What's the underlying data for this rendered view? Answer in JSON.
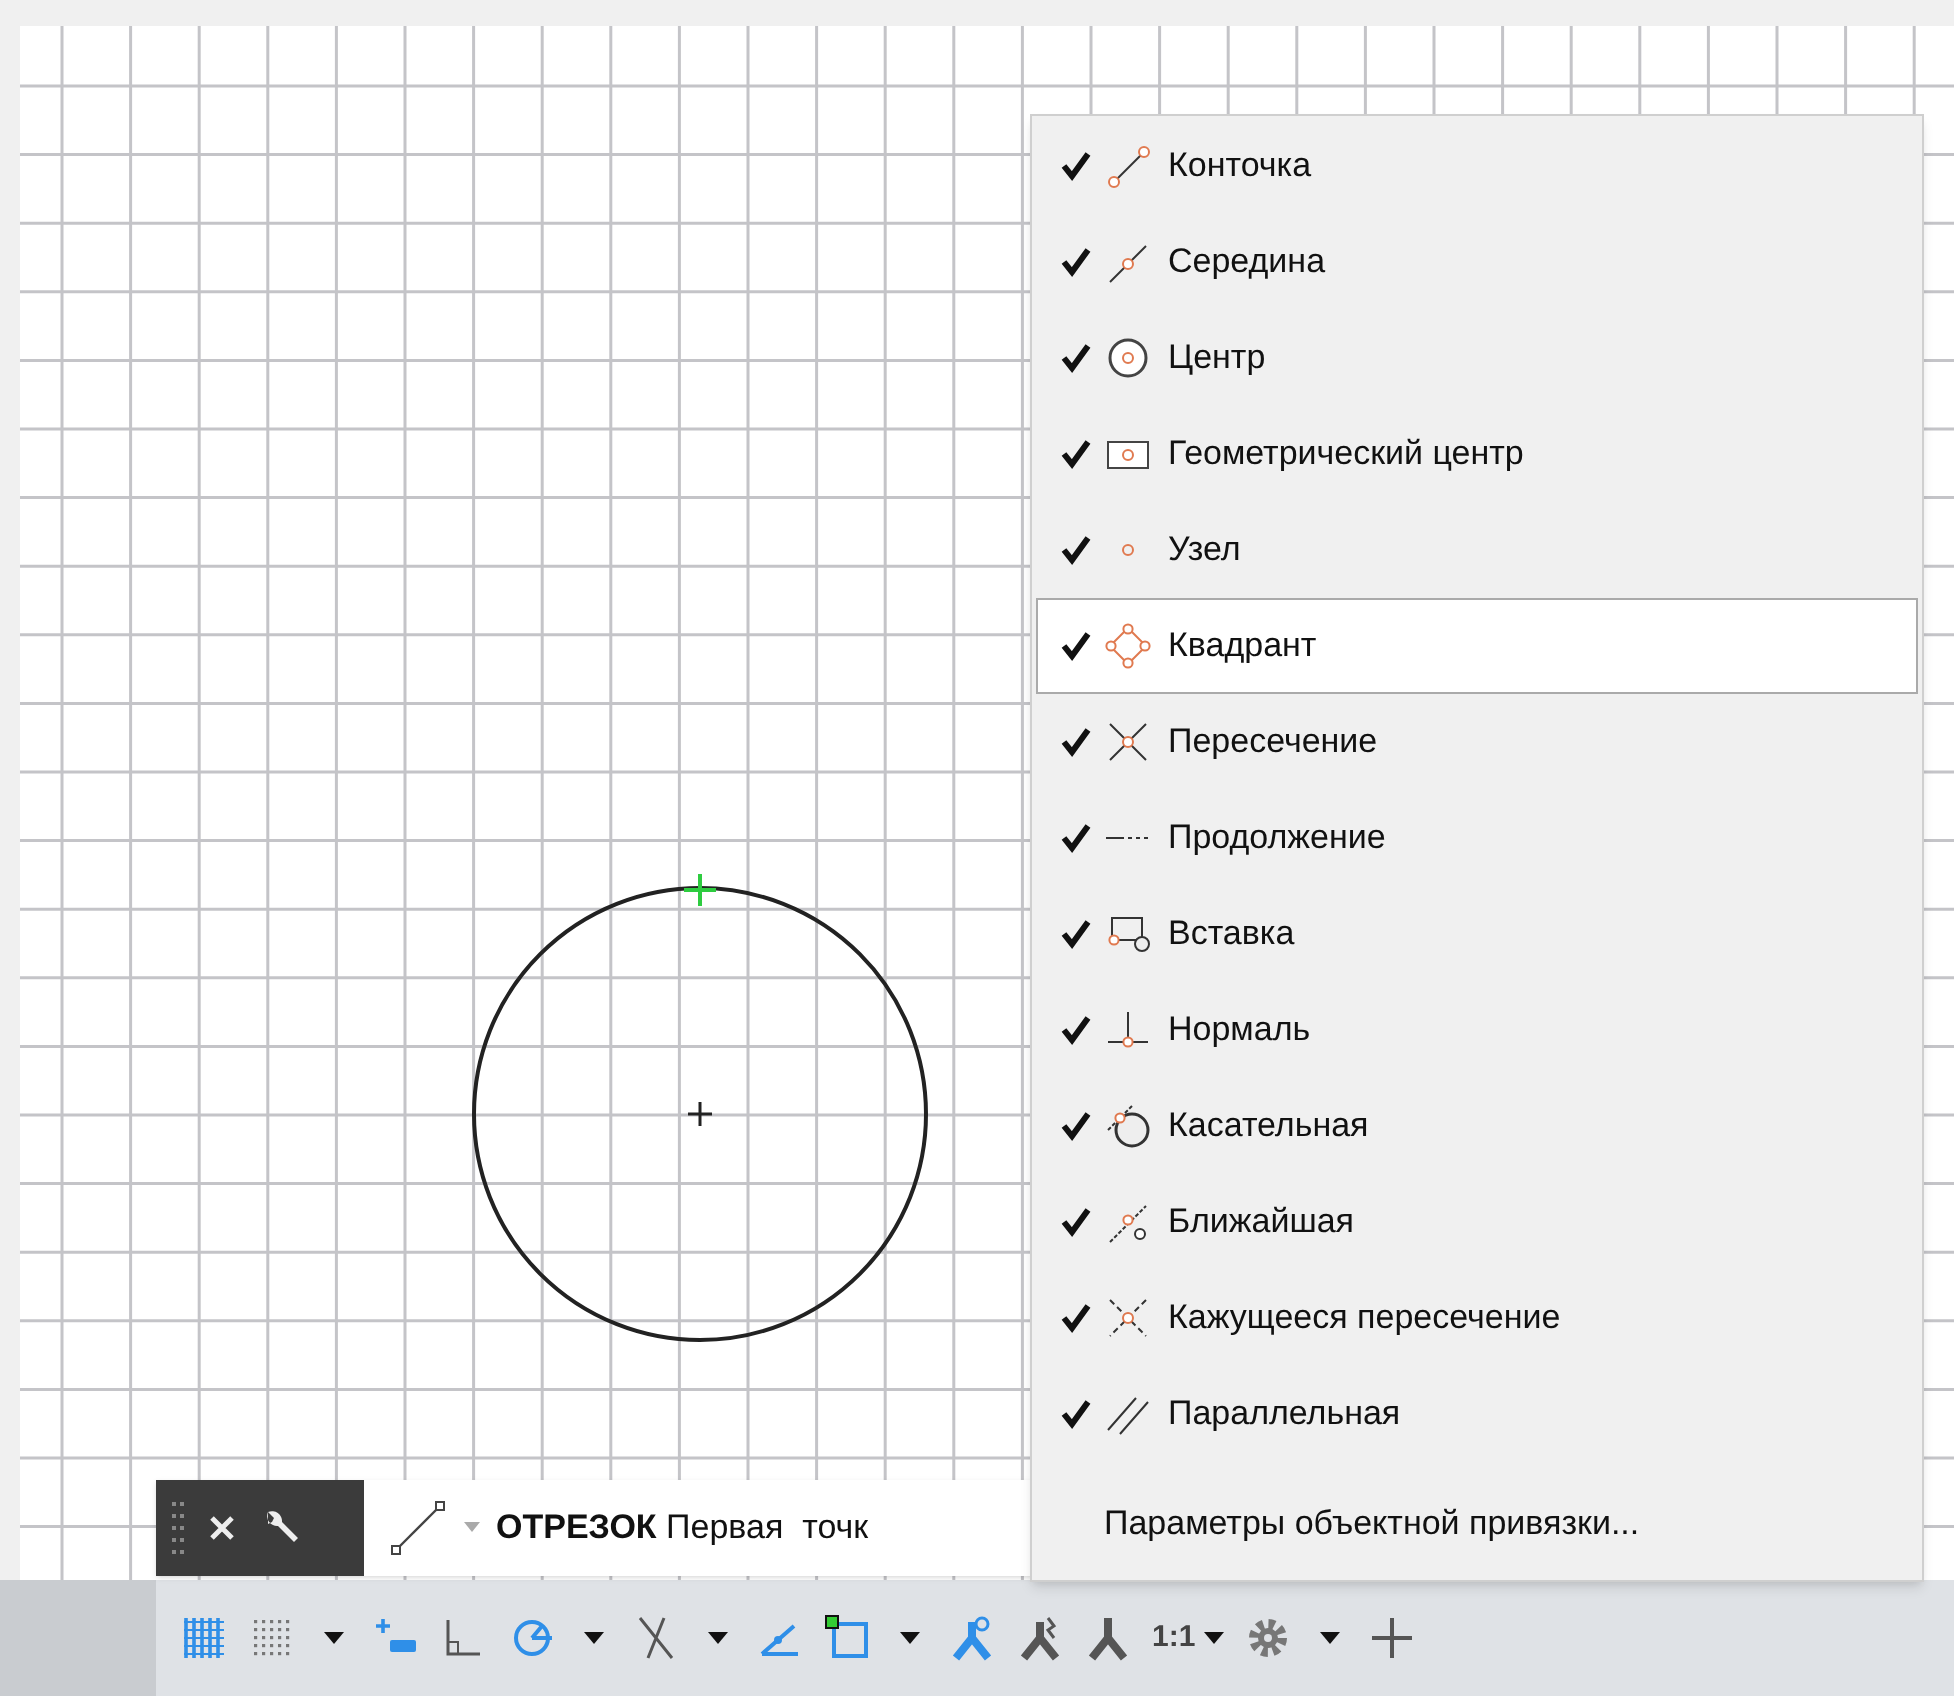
{
  "snap_menu": {
    "items": [
      {
        "kind": "endpoint",
        "label": "Конточка",
        "checked": true,
        "selected": false
      },
      {
        "kind": "midpoint",
        "label": "Середина",
        "checked": true,
        "selected": false
      },
      {
        "kind": "center",
        "label": "Центр",
        "checked": true,
        "selected": false
      },
      {
        "kind": "geocenter",
        "label": "Геометрический центр",
        "checked": true,
        "selected": false
      },
      {
        "kind": "node",
        "label": "Узел",
        "checked": true,
        "selected": false
      },
      {
        "kind": "quadrant",
        "label": "Квадрант",
        "checked": true,
        "selected": true
      },
      {
        "kind": "intersection",
        "label": "Пересечение",
        "checked": true,
        "selected": false
      },
      {
        "kind": "extension",
        "label": "Продолжение",
        "checked": true,
        "selected": false
      },
      {
        "kind": "insertion",
        "label": "Вставка",
        "checked": true,
        "selected": false
      },
      {
        "kind": "perpendicular",
        "label": "Нормаль",
        "checked": true,
        "selected": false
      },
      {
        "kind": "tangent",
        "label": "Касательная",
        "checked": true,
        "selected": false
      },
      {
        "kind": "nearest",
        "label": "Ближайшая",
        "checked": true,
        "selected": false
      },
      {
        "kind": "apparent",
        "label": "Кажущееся пересечение",
        "checked": true,
        "selected": false
      },
      {
        "kind": "parallel",
        "label": "Параллельная",
        "checked": true,
        "selected": false
      }
    ],
    "settings_label": "Параметры объектной привязки..."
  },
  "command_line": {
    "prompt": "**ОТРЕЗОК** Первая  точк"
  },
  "status_bar": {
    "tools": [
      {
        "kind": "grid",
        "on": true
      },
      {
        "kind": "snap"
      },
      {
        "kind": "caret"
      },
      {
        "kind": "dynamic",
        "on": true
      },
      {
        "kind": "ortho",
        "on": false
      },
      {
        "kind": "polar",
        "on": true
      },
      {
        "kind": "caret"
      },
      {
        "kind": "tracking",
        "on": false
      },
      {
        "kind": "caret"
      },
      {
        "kind": "angle",
        "on": true
      },
      {
        "kind": "osnap",
        "on": true
      },
      {
        "kind": "caret"
      },
      {
        "kind": "annotation",
        "on": true
      },
      {
        "kind": "annotation2",
        "on": false
      },
      {
        "kind": "annotation3",
        "on": false
      },
      {
        "kind": "scale",
        "text": "1:1"
      },
      {
        "kind": "gear"
      },
      {
        "kind": "caret"
      },
      {
        "kind": "plus"
      }
    ]
  }
}
